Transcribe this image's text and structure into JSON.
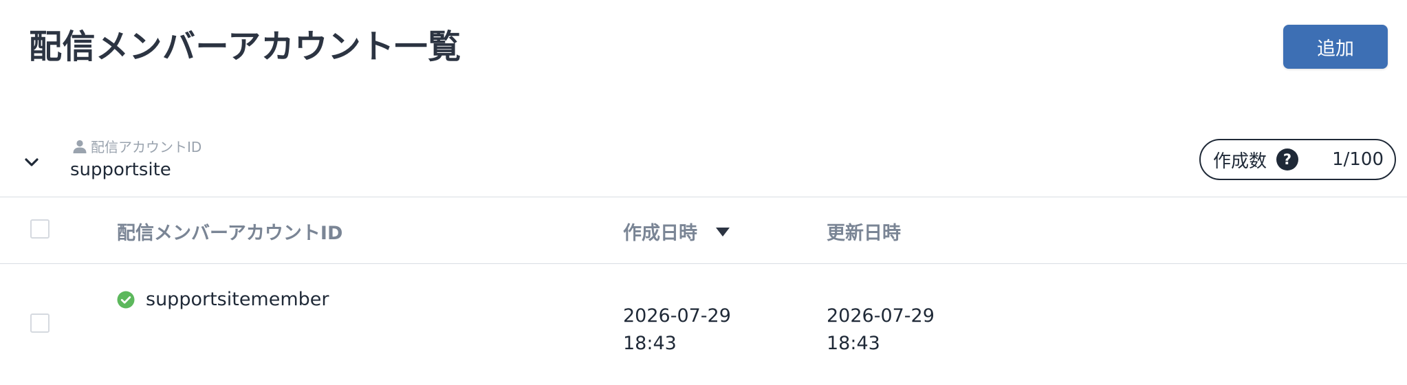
{
  "header": {
    "title": "配信メンバーアカウント一覧",
    "add_label": "追加",
    "accent_color": "#3d6fb4"
  },
  "account": {
    "label": "配信アカウントID",
    "id": "supportsite",
    "count_label": "作成数",
    "count_value": "1/100",
    "help_symbol": "?"
  },
  "table": {
    "columns": {
      "member_id": "配信メンバーアカウントID",
      "created": "作成日時",
      "updated": "更新日時"
    },
    "sort_column": "created",
    "sort_direction": "desc",
    "rows": [
      {
        "member_id": "supportsitemember",
        "status": "active",
        "status_color": "#5cb85c",
        "created_date": "2026-07-29",
        "created_time": "18:43",
        "updated_date": "2026-07-29",
        "updated_time": "18:43"
      }
    ]
  },
  "icons": {
    "collapse": "chevron-down-icon",
    "account": "person-icon",
    "help": "question-circle-icon",
    "sort": "triangle-down-icon",
    "status": "check-circle-icon"
  }
}
